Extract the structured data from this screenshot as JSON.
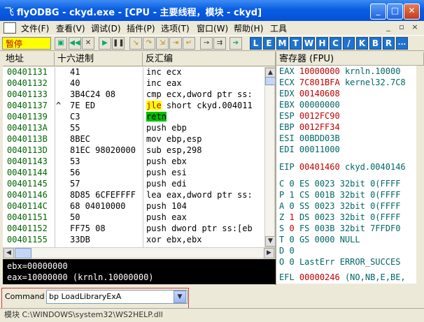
{
  "window": {
    "app_icon": "飞",
    "title": "flyODBG - ckyd.exe - [CPU - 主要线程，模块 - ckyd]",
    "controls": [
      "_",
      "□",
      "✕"
    ]
  },
  "menu": [
    "文件(F)",
    "查看(V)",
    "调试(D)",
    "插件(P)",
    "选项(T)",
    "窗口(W)",
    "帮助(H)",
    "工具"
  ],
  "mdi_controls": [
    "_",
    "▫",
    "×"
  ],
  "toolbar": {
    "status": "暂停",
    "letters": [
      "L",
      "E",
      "M",
      "T",
      "W",
      "H",
      "C",
      "/",
      "K",
      "B",
      "R",
      "..."
    ]
  },
  "disasm": {
    "headers": [
      "地址",
      "十六进制",
      "反汇编"
    ],
    "rows": [
      {
        "addr": "00401131",
        "jmp": "",
        "hex": "41",
        "asm": "inc ecx"
      },
      {
        "addr": "00401132",
        "jmp": "",
        "hex": "40",
        "asm": "inc eax"
      },
      {
        "addr": "00401133",
        "jmp": "",
        "hex": "3B4C24 08",
        "asm": "cmp ecx,dword ptr ss:"
      },
      {
        "addr": "00401137",
        "jmp": "^",
        "hex": "7E ED",
        "asm_kw": "jle",
        "asm_rest": " short ckyd.004011"
      },
      {
        "addr": "00401139",
        "jmp": "",
        "hex": "C3",
        "asm_kw2": "retn"
      },
      {
        "addr": "0040113A",
        "jmp": "",
        "hex": "55",
        "asm": "push ebp"
      },
      {
        "addr": "0040113B",
        "jmp": "",
        "hex": "8BEC",
        "asm": "mov ebp,esp"
      },
      {
        "addr": "0040113D",
        "jmp": "",
        "hex": "81EC 98020000",
        "asm": "sub esp,298"
      },
      {
        "addr": "00401143",
        "jmp": "",
        "hex": "53",
        "asm": "push ebx"
      },
      {
        "addr": "00401144",
        "jmp": "",
        "hex": "56",
        "asm": "push esi"
      },
      {
        "addr": "00401145",
        "jmp": "",
        "hex": "57",
        "asm": "push edi"
      },
      {
        "addr": "00401146",
        "jmp": "",
        "hex": "8D85 6CFEFFFF",
        "asm": "lea eax,dword ptr ss:"
      },
      {
        "addr": "0040114C",
        "jmp": "",
        "hex": "68 04010000",
        "asm": "push 104"
      },
      {
        "addr": "00401151",
        "jmp": "",
        "hex": "50",
        "asm": "push eax"
      },
      {
        "addr": "00401152",
        "jmp": "",
        "hex": "FF75 08",
        "asm": "push dword ptr ss:[eb"
      },
      {
        "addr": "00401155",
        "jmp": "",
        "hex": "33DB",
        "asm": "xor ebx,ebx"
      }
    ]
  },
  "registers": {
    "header": "寄存器 (FPU)",
    "gp": [
      {
        "name": "EAX",
        "value": "10000000",
        "comment": "krnln.10000"
      },
      {
        "name": "ECX",
        "value": "7C801BFA",
        "comment": "kernel32.7C8"
      },
      {
        "name": "EDX",
        "value": "00140608",
        "comment": ""
      },
      {
        "name": "EBX",
        "value": "00000000",
        "comment": ""
      },
      {
        "name": "ESP",
        "value": "0012FC90",
        "comment": ""
      },
      {
        "name": "EBP",
        "value": "0012FF34",
        "comment": ""
      },
      {
        "name": "ESI",
        "value": "00BDD03B",
        "comment": ""
      },
      {
        "name": "EDI",
        "value": "00011000",
        "comment": ""
      }
    ],
    "eip": {
      "name": "EIP",
      "value": "00401460",
      "comment": "ckyd.0040146"
    },
    "flags": [
      {
        "flag": "C",
        "val": "0",
        "seg": "ES 0023 32bit 0(FFFF"
      },
      {
        "flag": "P",
        "val": "1",
        "seg": "CS 001B 32bit 0(FFFF"
      },
      {
        "flag": "A",
        "val": "0",
        "seg": "SS 0023 32bit 0(FFFF"
      },
      {
        "flag": "Z",
        "val": "1",
        "seg": "DS 0023 32bit 0(FFFF"
      },
      {
        "flag": "S",
        "val": "0",
        "seg": "FS 003B 32bit 7FFDF0"
      },
      {
        "flag": "T",
        "val": "0",
        "seg": "GS 0000 NULL"
      },
      {
        "flag": "D",
        "val": "0",
        "seg": ""
      },
      {
        "flag": "O",
        "val": "0",
        "seg": "LastErr ERROR_SUCCES"
      }
    ],
    "efl": {
      "name": "EFL",
      "value": "00000246",
      "comment": "(NO,NB,E,BE,"
    }
  },
  "info": {
    "line1": "ebx=00000000",
    "line2": "eax=10000000 (krnln.10000000)"
  },
  "command": {
    "label": "Command :",
    "value": "bp LoadLibraryExA"
  },
  "statusbar": "模块 C:\\WINDOWS\\system32\\WS2HELP.dll",
  "colors": {
    "addr": "#006600",
    "changed_reg": "#c00000",
    "reg_name": "#006666",
    "jle_bg": "#ffff00",
    "retn_bg": "#00c000"
  }
}
